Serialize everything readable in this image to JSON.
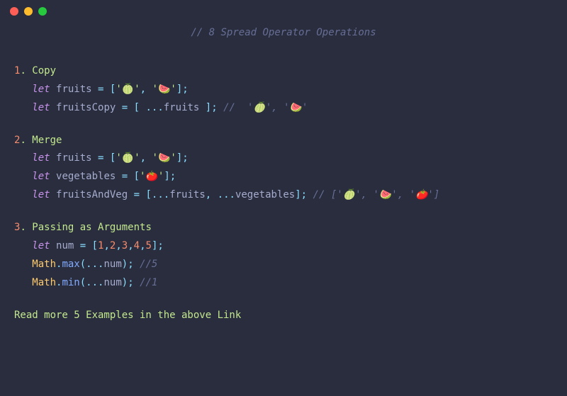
{
  "titleComment": "// 8 Spread Operator Operations",
  "sections": {
    "s1": {
      "num": "1",
      "title": ". Copy",
      "kwLet": "let",
      "fruits": "fruits",
      "eq": " = ",
      "lb": "[",
      "rb": "]",
      "q": "'",
      "melon": "🍈",
      "comma": ", ",
      "watermelon": "🍉",
      "semi": ";",
      "fruitsCopy": "fruitsCopy",
      "spread": "...",
      "space": " ",
      "commentPrefix": "// ",
      "commentBody": " '🍈', '🍉'"
    },
    "s2": {
      "num": "2",
      "title": ". Merge",
      "kwLet": "let",
      "fruits": "fruits",
      "eq": " = ",
      "lb": "[",
      "rb": "]",
      "q": "'",
      "melon": "🍈",
      "comma": ", ",
      "watermelon": "🍉",
      "semi": ";",
      "vegetables": "vegetables",
      "tomato": "🍅",
      "fruitsAndVeg": "fruitsAndVeg",
      "spread": "...",
      "commentPrefix": "// ",
      "commentBody": "['🍈', '🍉', '🍅']"
    },
    "s3": {
      "num": "3",
      "title": ". Passing as Arguments",
      "kwLet": "let",
      "numVar": "num",
      "eq": " = ",
      "lb": "[",
      "rb": "]",
      "semi": ";",
      "n1": "1",
      "n2": "2",
      "n3": "3",
      "n4": "4",
      "n5": "5",
      "c": ",",
      "math": "Math",
      "dot": ".",
      "max": "max",
      "min": "min",
      "lp": "(",
      "rp": ")",
      "spread": "...",
      "comment5": "//5",
      "comment1": "//1"
    }
  },
  "footer": "Read more 5 Examples in the above Link"
}
